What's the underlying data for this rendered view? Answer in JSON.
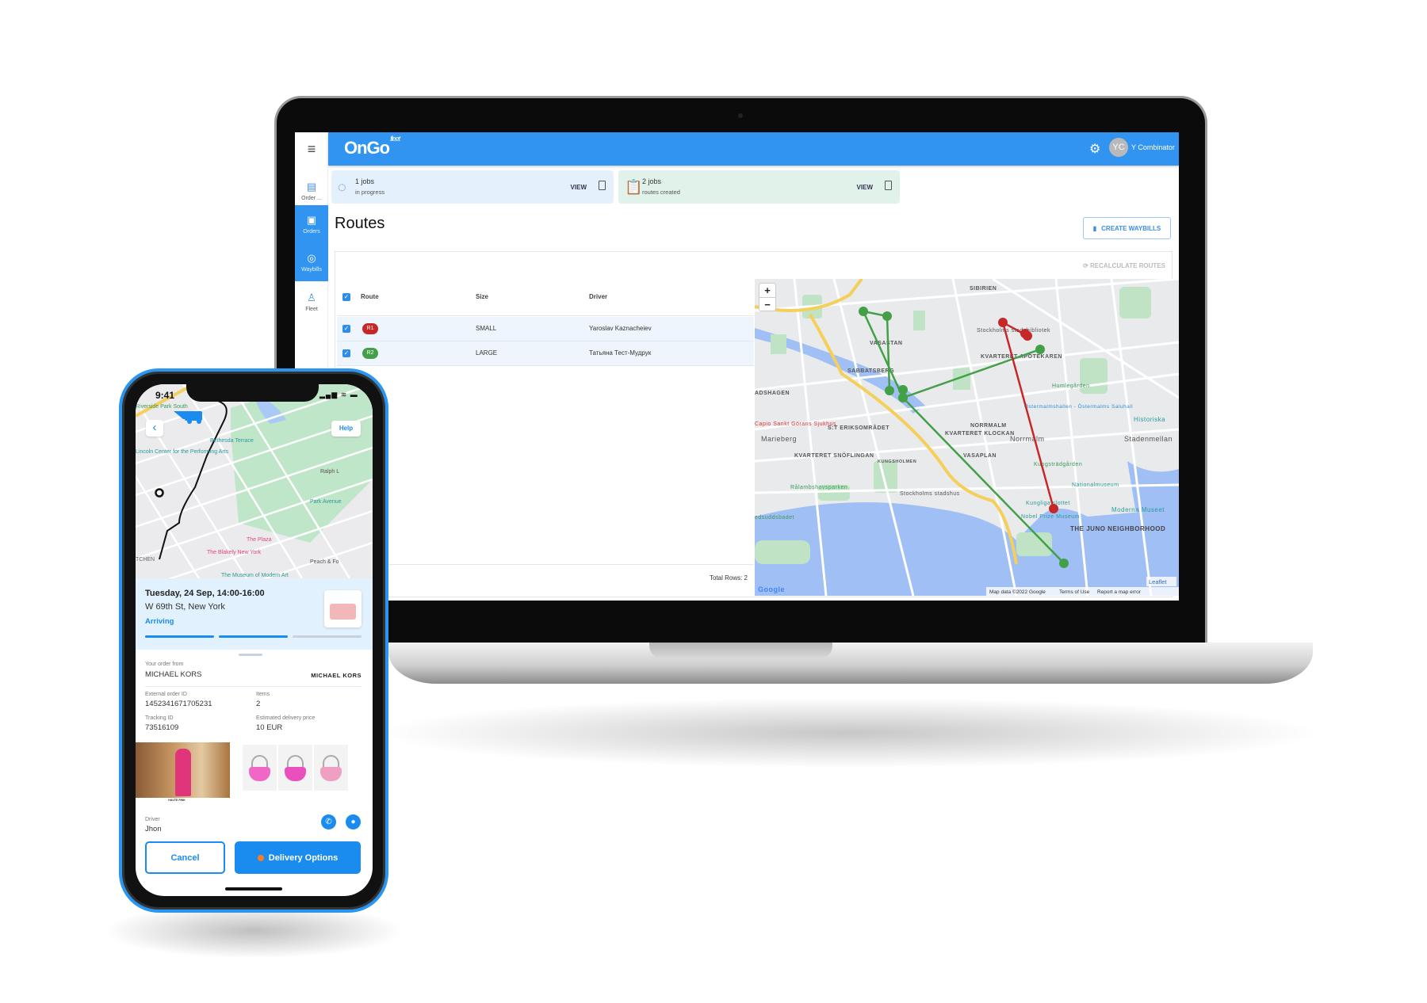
{
  "laptop": {
    "app": {
      "logo": "OnGo",
      "logo_sub": "fleet",
      "menu_icon": "hamburger-icon",
      "user": {
        "initials": "YC",
        "name": "Y Combinator"
      },
      "sidebar": [
        {
          "label": "Order ...",
          "icon": "order-icon"
        },
        {
          "label": "Orders",
          "icon": "orders-icon",
          "active": true
        },
        {
          "label": "Waybills",
          "icon": "waybills-icon",
          "active": true
        },
        {
          "label": "Fleet",
          "icon": "fleet-icon"
        }
      ],
      "cards": [
        {
          "title": "1 jobs",
          "subtitle": "in progress",
          "action": "VIEW",
          "icon": "spinner-icon",
          "bg": "#e4f0fb"
        },
        {
          "title": "2 jobs",
          "subtitle": "routes created",
          "action": "VIEW",
          "icon": "clipboard-clock-icon",
          "bg": "#e0f2ea"
        }
      ],
      "page_title": "Routes",
      "create_waybills": "CREATE WAYBILLS",
      "recalculate_routes": "RECALCULATE ROUTES",
      "table": {
        "columns": [
          "Route",
          "Size",
          "Driver"
        ],
        "rows": [
          {
            "route": "R1",
            "size": "SMALL",
            "driver": "Yaroslav Kaznacheiev",
            "color": "#c62828",
            "checked": true
          },
          {
            "route": "R2",
            "size": "LARGE",
            "driver": "Татьяна Тест-Мудрук",
            "color": "#43a047",
            "checked": true
          }
        ],
        "total_rows": "Total Rows: 2"
      },
      "map": {
        "zoom_in": "+",
        "zoom_out": "−",
        "labels": [
          "SIBIRIEN",
          "VASASTAN",
          "SABBATSBERG",
          "KVARTERET APOTEKAREN",
          "Stockholms stadsbibliotek",
          "ADSHAGEN",
          "Capio Sankt Görans Sjukhus",
          "S:T ERIKSOMRÅDET",
          "NORRMALM",
          "Marieberg",
          "Norrmalm",
          "Stadenmellan",
          "KVARTERET KLOCKAN",
          "KVARTERET SNÖFLINGAN",
          "VASAPLAN",
          "KUNGSHOLMEN",
          "Humlegården",
          "Östermalmshallen - Östermalms Saluhall",
          "Historiska",
          "Kungsträdgården",
          "Rålambshovsparken",
          "Stockholms stadshus",
          "Nationalmuseum",
          "Kungliga slottet",
          "Moderna Museet",
          "Nobel Prize Museum",
          "THE JUNO NEIGHBORHOOD",
          "edsuddsbadet",
          "Google",
          "Leaflet",
          "Map data ©2022 Google",
          "Terms of Use",
          "Report a map error"
        ],
        "colors": {
          "route_r1": "#c62828",
          "route_r2": "#43a047",
          "water": "#9fbff5",
          "park": "#bfe3c4"
        }
      }
    }
  },
  "phone": {
    "time": "9:41",
    "status_icons": "signal wifi battery",
    "help": "Help",
    "map_labels": [
      "Riverside Park South",
      "Lincoln Center for the Performing Arts",
      "Bethesda Terrace",
      "Ralph L",
      "Park Avenue",
      "The Plaza",
      "The Blakely New York",
      "Peach & Fo",
      "The Museum of Modern Art",
      "TCHEN"
    ],
    "delivery": {
      "date": "Tuesday, 24 Sep, 14:00-16:00",
      "address": "W 69th St, New York",
      "status": "Arriving",
      "progress_steps_done": 2,
      "progress_steps_total": 3
    },
    "order": {
      "from_label": "Your order from",
      "from_value": "MICHAEL KORS",
      "brand_logo": "MICHAEL KORS",
      "external_id_label": "External order ID",
      "external_id": "1452341671705231",
      "items_label": "Items",
      "items": "2",
      "tracking_label": "Tracking ID",
      "tracking_id": "73516109",
      "price_label": "Estimated delivery price",
      "price": "10 EUR",
      "photo_caption": "HAUTE PINK"
    },
    "driver_label": "Driver",
    "driver_name": "Jhon",
    "cancel": "Cancel",
    "delivery_options": "Delivery Options",
    "accent": "#1a8cf0"
  }
}
